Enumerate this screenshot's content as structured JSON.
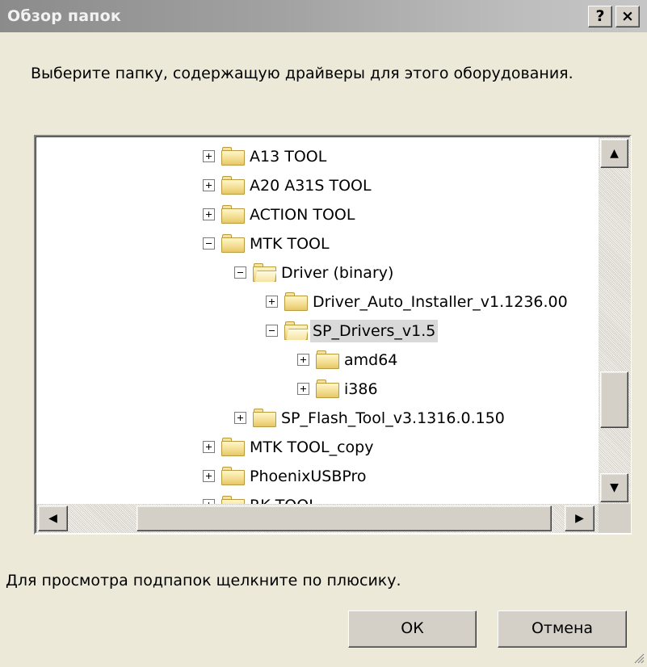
{
  "dialog": {
    "title": "Обзор папок",
    "help_label": "?",
    "close_label": "×",
    "instruction": "Выберите папку, содержащую драйверы для этого оборудования.",
    "hint": "Для просмотра подпапок щелкните по плюсику.",
    "ok_label": "ОК",
    "cancel_label": "Отмена"
  },
  "tree": {
    "items": [
      {
        "label": "A13 TOOL",
        "level": 0,
        "expander": "plus",
        "folder": "closed"
      },
      {
        "label": "A20 A31S TOOL",
        "level": 0,
        "expander": "plus",
        "folder": "closed"
      },
      {
        "label": "ACTION TOOL",
        "level": 0,
        "expander": "plus",
        "folder": "closed"
      },
      {
        "label": "MTK TOOL",
        "level": 0,
        "expander": "minus",
        "folder": "closed"
      },
      {
        "label": "Driver (binary)",
        "level": 1,
        "expander": "minus",
        "folder": "open"
      },
      {
        "label": "Driver_Auto_Installer_v1.1236.00",
        "level": 2,
        "expander": "plus",
        "folder": "closed"
      },
      {
        "label": "SP_Drivers_v1.5",
        "level": 2,
        "expander": "minus",
        "folder": "open",
        "selected": true
      },
      {
        "label": "amd64",
        "level": 3,
        "expander": "plus",
        "folder": "closed"
      },
      {
        "label": "i386",
        "level": 3,
        "expander": "plus",
        "folder": "closed"
      },
      {
        "label": "SP_Flash_Tool_v3.1316.0.150",
        "level": 1,
        "expander": "plus",
        "folder": "closed"
      },
      {
        "label": "MTK TOOL_copy",
        "level": 0,
        "expander": "plus",
        "folder": "closed"
      },
      {
        "label": "PhoenixUSBPro",
        "level": 0,
        "expander": "plus",
        "folder": "closed"
      },
      {
        "label": "RK TOOL",
        "level": 0,
        "expander": "plus",
        "folder": "closed"
      },
      {
        "label": "",
        "level": 0,
        "expander": "minus",
        "folder": "closed"
      }
    ]
  },
  "scrollbars": {
    "up_arrow": "▲",
    "down_arrow": "▼",
    "left_arrow": "◀",
    "right_arrow": "▶"
  },
  "colors": {
    "dialog_face": "#ece9d8",
    "titlebar": "#8b8b8b",
    "selection": "#d9d9d9"
  }
}
